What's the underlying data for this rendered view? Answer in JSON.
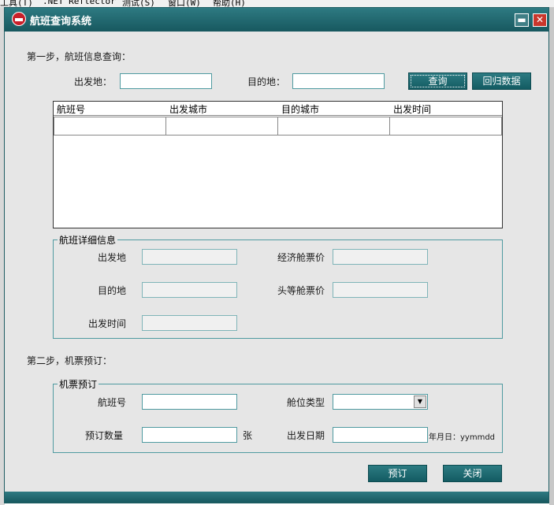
{
  "background": {
    "menu_items": [
      "工具(T)",
      ".NET Reflector",
      "测试(S)",
      "窗口(W)",
      "帮助(H)"
    ]
  },
  "window": {
    "title": "航班查询系统",
    "minimize_glyph": "▬",
    "close_glyph": "✕"
  },
  "step1": {
    "heading": "第一步，航班信息查询：",
    "departure_label": "出发地：",
    "departure_value": "",
    "destination_label": "目的地：",
    "destination_value": "",
    "query_button": "查询",
    "reset_button": "回归数据"
  },
  "grid": {
    "columns": [
      "航班号",
      "出发城市",
      "目的城市",
      "出发时间"
    ],
    "rows": [
      [
        "",
        "",
        "",
        ""
      ]
    ]
  },
  "details": {
    "legend": "航班详细信息",
    "departure_label": "出发地",
    "destination_label": "目的地",
    "time_label": "出发时间",
    "economy_label": "经济舱票价",
    "first_label": "头等舱票价",
    "departure_value": "",
    "destination_value": "",
    "time_value": "",
    "economy_value": "",
    "first_value": ""
  },
  "step2": {
    "heading": "第二步，机票预订：",
    "legend": "机票预订",
    "flight_no_label": "航班号",
    "flight_no_value": "",
    "cabin_label": "舱位类型",
    "cabin_value": "",
    "quantity_label": "预订数量",
    "quantity_value": "",
    "quantity_unit": "张",
    "date_label": "出发日期",
    "date_value": "",
    "date_hint": "年月日：yymmdd"
  },
  "actions": {
    "book_button": "预订",
    "close_button": "关闭"
  },
  "colors": {
    "titlebar": "#17585f",
    "button": "#1f6b72",
    "border": "#4f9aa0",
    "window_bg": "#e6e6e6"
  }
}
